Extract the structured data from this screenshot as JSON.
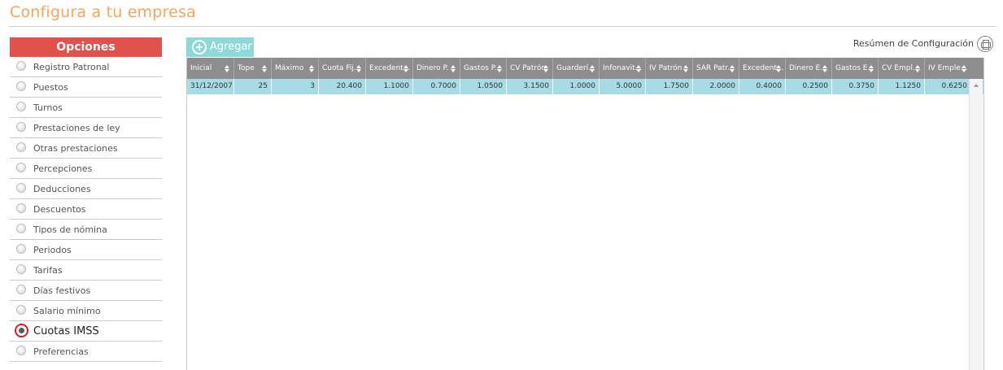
{
  "page": {
    "title": "Configura a tu empresa"
  },
  "sidebar": {
    "header": "Opciones",
    "items": [
      {
        "label": "Registro Patronal",
        "active": false
      },
      {
        "label": "Puestos",
        "active": false
      },
      {
        "label": "Turnos",
        "active": false
      },
      {
        "label": "Prestaciones de ley",
        "active": false
      },
      {
        "label": "Otras prestaciones",
        "active": false
      },
      {
        "label": "Percepciones",
        "active": false
      },
      {
        "label": "Deducciones",
        "active": false
      },
      {
        "label": "Descuentos",
        "active": false
      },
      {
        "label": "Tipos de nómina",
        "active": false
      },
      {
        "label": "Periodos",
        "active": false
      },
      {
        "label": "Tarifas",
        "active": false
      },
      {
        "label": "Días festivos",
        "active": false
      },
      {
        "label": "Salario mínimo",
        "active": false
      },
      {
        "label": "Cuotas IMSS",
        "active": true
      },
      {
        "label": "Preferencias",
        "active": false
      }
    ]
  },
  "toolbar": {
    "add_label": "Agregar",
    "summary_label": "Resúmen de Configuración"
  },
  "grid": {
    "columns": [
      "Inicial",
      "Tope",
      "Máximo",
      "Cuota Fij...",
      "Excedent...",
      "Dinero P.",
      "Gastos P.",
      "CV Patrón",
      "Guarderí...",
      "Infonavit...",
      "IV Patrón",
      "SAR Patr...",
      "Excedent...",
      "Dinero E.",
      "Gastos E.",
      "CV Empl...",
      "IV Emple..."
    ],
    "rows": [
      [
        "31/12/2007",
        "25",
        "3",
        "20.400",
        "1.1000",
        "0.7000",
        "1.0500",
        "3.1500",
        "1.0000",
        "5.0000",
        "1.7500",
        "2.0000",
        "0.4000",
        "0.2500",
        "0.3750",
        "1.1250",
        "0.6250"
      ]
    ]
  },
  "colors": {
    "title": "#f5a65b",
    "sidebar_header": "#e0524c",
    "add_button": "#8fd8d8",
    "grid_header": "#8d8d8d",
    "selected_row": "#a7dce6",
    "active_radio_ring": "#d71f25"
  }
}
